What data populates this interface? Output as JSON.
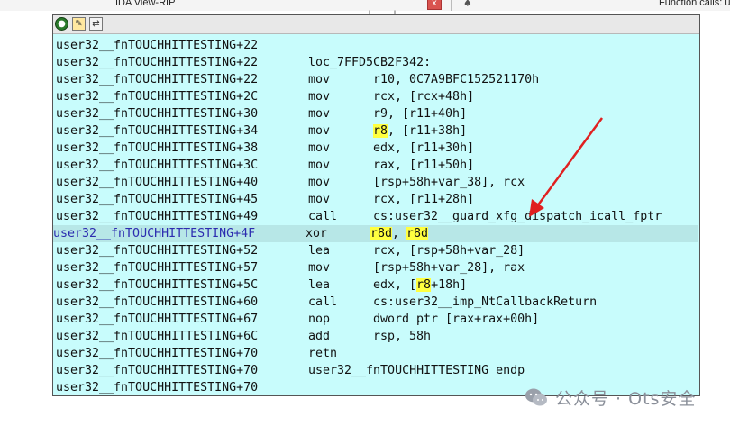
{
  "background": {
    "tab_title": "IDA View-RIP",
    "tab_close": "x",
    "function_calls_title": "Function calls: us",
    "bg_glyphs": "·|·|·"
  },
  "popup": {
    "toolbar": {
      "icon1": "●",
      "icon2": "✎",
      "icon3": "⇄"
    },
    "lines": [
      {
        "addr": "user32__fnTOUCHHITTESTING+22"
      },
      {
        "addr": "user32__fnTOUCHHITTESTING+22",
        "label": "loc_7FFD5CB2F342:"
      },
      {
        "addr": "user32__fnTOUCHHITTESTING+22",
        "mn": "mov",
        "ops": "r10, 0C7A9BFC152521170h"
      },
      {
        "addr": "user32__fnTOUCHHITTESTING+2C",
        "mn": "mov",
        "ops": "rcx, [rcx+48h]"
      },
      {
        "addr": "user32__fnTOUCHHITTESTING+30",
        "mn": "mov",
        "ops": "r9, [r11+40h]"
      },
      {
        "addr": "user32__fnTOUCHHITTESTING+34",
        "mn": "mov",
        "op_hl": "r8",
        "ops_rest": ", [r11+38h]"
      },
      {
        "addr": "user32__fnTOUCHHITTESTING+38",
        "mn": "mov",
        "ops": "edx, [r11+30h]"
      },
      {
        "addr": "user32__fnTOUCHHITTESTING+3C",
        "mn": "mov",
        "ops": "rax, [r11+50h]"
      },
      {
        "addr": "user32__fnTOUCHHITTESTING+40",
        "mn": "mov",
        "ops": "[rsp+58h+var_38], rcx"
      },
      {
        "addr": "user32__fnTOUCHHITTESTING+45",
        "mn": "mov",
        "ops": "rcx, [r11+28h]"
      },
      {
        "addr": "user32__fnTOUCHHITTESTING+49",
        "mn": "call",
        "ops": "cs:user32__guard_xfg_dispatch_icall_fptr"
      },
      {
        "addr": "user32__fnTOUCHHITTESTING+4F",
        "mn": "xor",
        "op1": "r8d",
        "sep": ", ",
        "op2": "r8d"
      },
      {
        "addr": "user32__fnTOUCHHITTESTING+52",
        "mn": "lea",
        "ops": "rcx, [rsp+58h+var_28]"
      },
      {
        "addr": "user32__fnTOUCHHITTESTING+57",
        "mn": "mov",
        "ops": "[rsp+58h+var_28], rax"
      },
      {
        "addr": "user32__fnTOUCHHITTESTING+5C",
        "mn": "lea",
        "ops_pre": "edx, [",
        "op_hl": "r8",
        "ops_rest": "+18h]"
      },
      {
        "addr": "user32__fnTOUCHHITTESTING+60",
        "mn": "call",
        "ops": "cs:user32__imp_NtCallbackReturn"
      },
      {
        "addr": "user32__fnTOUCHHITTESTING+67",
        "mn": "nop",
        "ops": "dword ptr [rax+rax+00h]"
      },
      {
        "addr": "user32__fnTOUCHHITTESTING+6C",
        "mn": "add",
        "ops": "rsp, 58h"
      },
      {
        "addr": "user32__fnTOUCHHITTESTING+70",
        "mn": "retn"
      },
      {
        "addr": "user32__fnTOUCHHITTESTING+70",
        "label": "user32__fnTOUCHHITTESTING endp"
      },
      {
        "addr": "user32__fnTOUCHHITTESTING+70"
      }
    ]
  },
  "annotation": {
    "arrow_color": "#e02020"
  },
  "watermark": {
    "text": "公众号 · Ots安全"
  },
  "colors": {
    "popup_bg": "#c8fcfc",
    "highlight": "#ffff40",
    "current_line": "#b7e7e7",
    "current_addr": "#2c2cb0"
  }
}
